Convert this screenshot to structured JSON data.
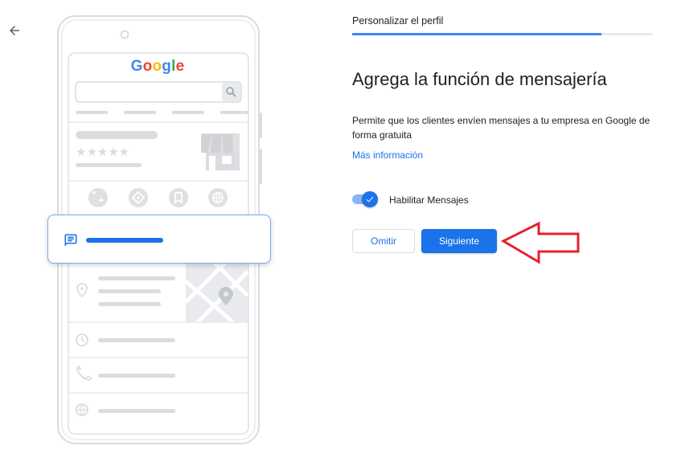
{
  "header": {
    "back_icon": "arrow-left-icon",
    "step_label": "Personalizar el perfil",
    "progress_fraction": 0.83
  },
  "illustration": {
    "logo_text": "Google",
    "logo_colors": [
      "#4285f4",
      "#ea4335",
      "#fbbc05",
      "#4285f4",
      "#34a853",
      "#ea4335"
    ],
    "icons": [
      "search-icon",
      "phone-icon",
      "directions-icon",
      "bookmark-icon",
      "globe-icon",
      "location-pin-icon",
      "clock-icon",
      "message-icon"
    ],
    "rating_stars": "★★★★★"
  },
  "main": {
    "title": "Agrega la función de mensajería",
    "description": "Permite que los clientes envíen mensajes a tu empresa en Google de forma gratuita",
    "more_info_link": "Más información"
  },
  "toggle": {
    "label": "Habilitar Mensajes",
    "checked": true
  },
  "actions": {
    "skip_label": "Omitir",
    "next_label": "Siguiente"
  },
  "annotation": {
    "arrow_color": "#e8202a"
  },
  "colors": {
    "accent": "#1a73e8",
    "progress": "#4285f4",
    "placeholder_gray": "#dadce0"
  }
}
